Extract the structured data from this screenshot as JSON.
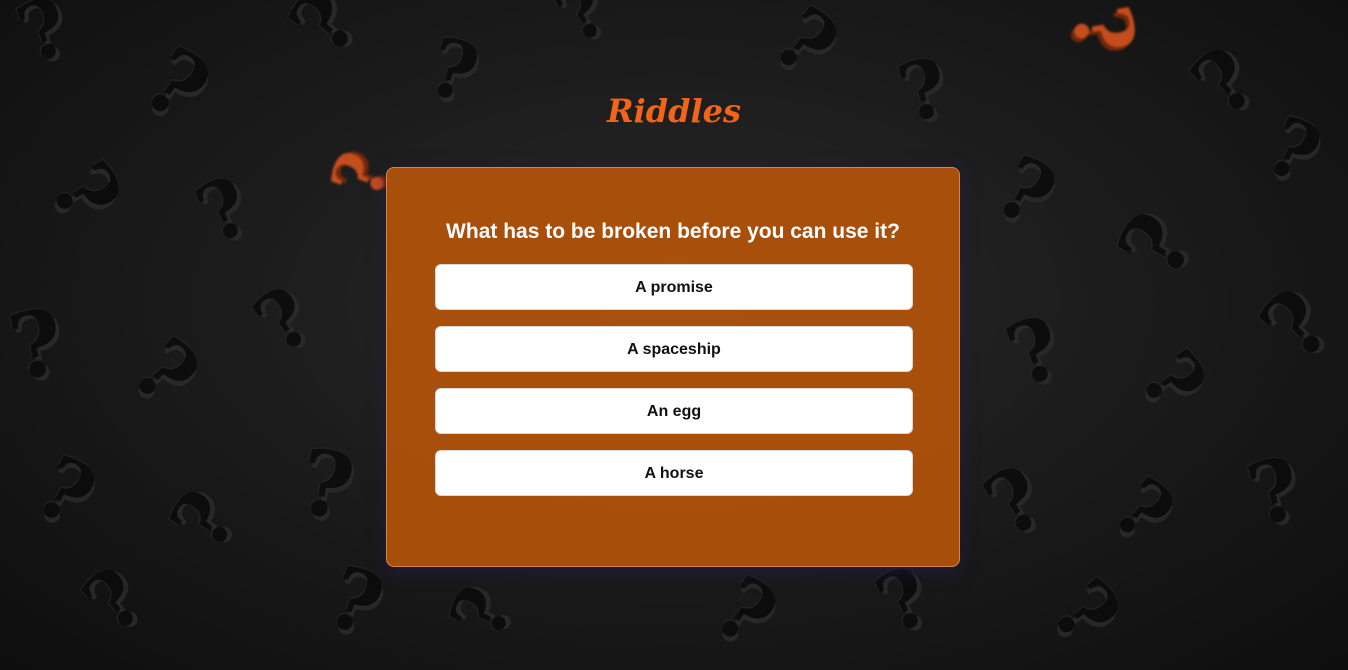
{
  "app": {
    "title": "Riddles",
    "accent_color": "#f26418",
    "card_color": "#b8540a"
  },
  "background": {
    "pattern_icon": "question-mark-icon",
    "glyph": "?"
  },
  "riddle": {
    "question": "What has to be broken before you can use it?",
    "answers": [
      {
        "label": "A promise"
      },
      {
        "label": "A spaceship"
      },
      {
        "label": "An egg"
      },
      {
        "label": "A horse"
      }
    ]
  }
}
